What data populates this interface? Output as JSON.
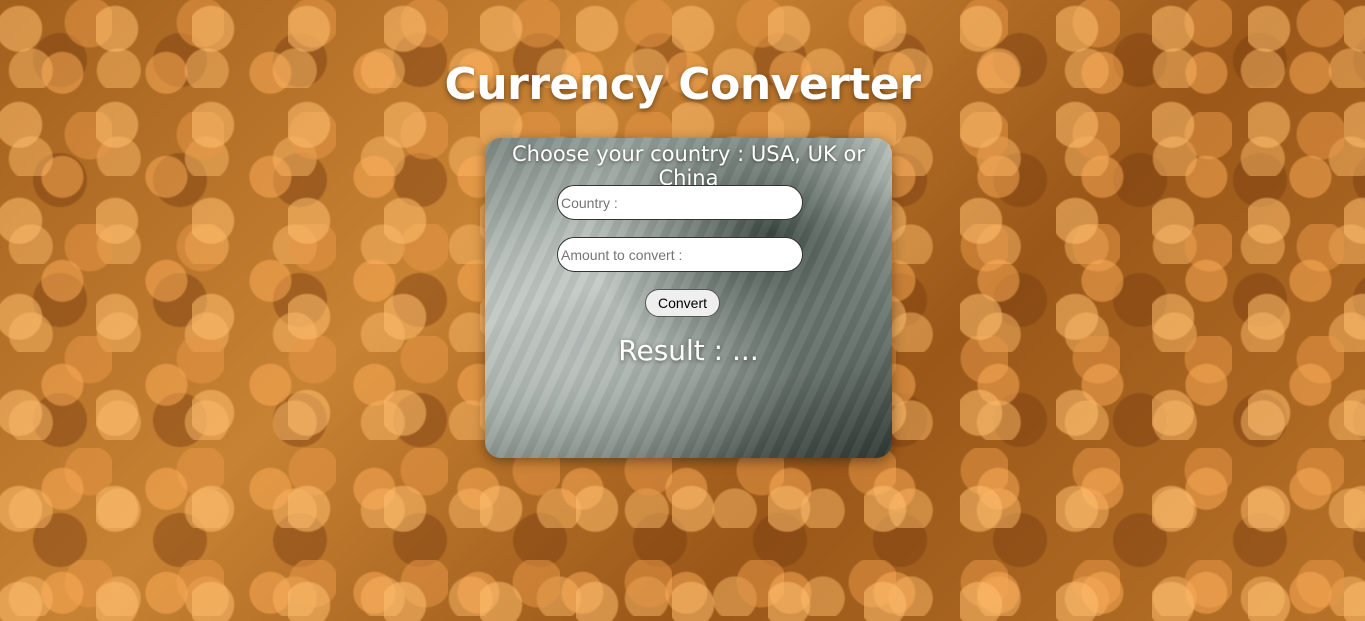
{
  "header": {
    "title": "Currency Converter"
  },
  "converter": {
    "heading": "Choose your country : USA, UK or China",
    "country_placeholder": "Country :",
    "country_value": "",
    "amount_placeholder": "Amount to convert :",
    "amount_value": "",
    "convert_label": "Convert",
    "result_text": "Result : ..."
  },
  "colors": {
    "title_text": "#ffffff",
    "background_copper": "#b87228"
  }
}
